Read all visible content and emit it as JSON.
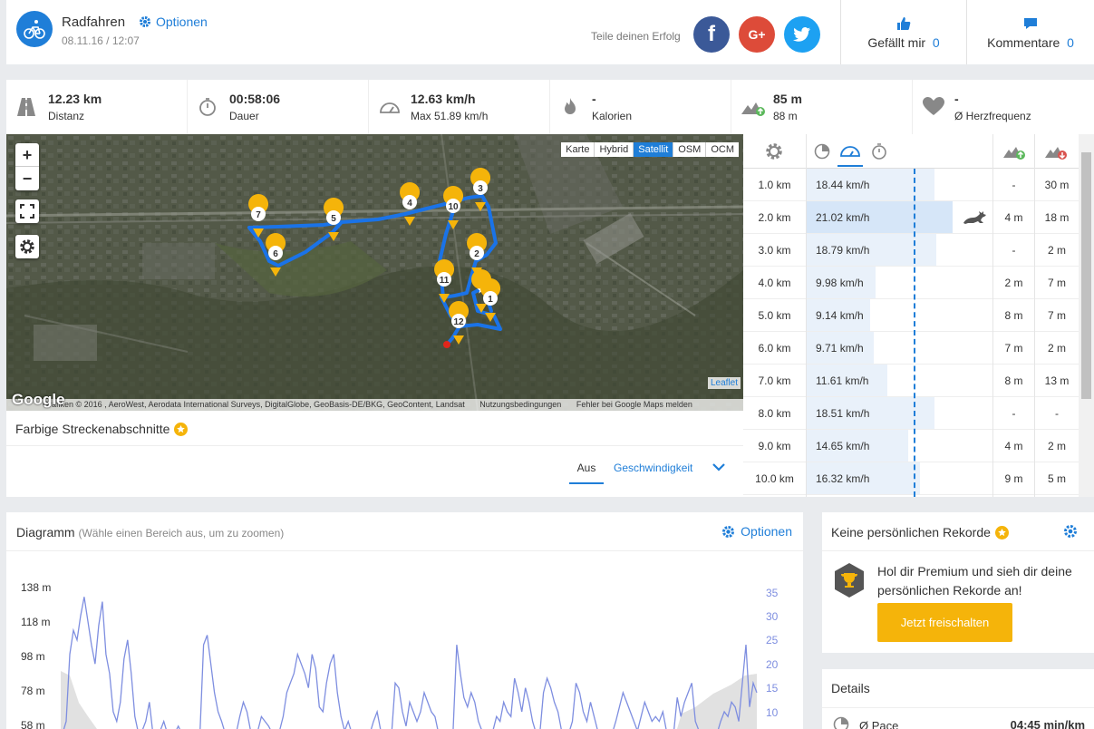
{
  "header": {
    "title": "Radfahren",
    "date": "08.11.16 / 12:07",
    "options_label": "Optionen",
    "share_label": "Teile deinen Erfolg",
    "like_label": "Gefällt mir",
    "like_count": "0",
    "comments_label": "Kommentare",
    "comments_count": "0",
    "sport_icon": "bicycle-icon"
  },
  "stats": [
    {
      "value": "12.23 km",
      "label": "Distanz",
      "icon": "road-icon"
    },
    {
      "value": "00:58:06",
      "label": "Dauer",
      "icon": "stopwatch-icon"
    },
    {
      "value": "12.63 km/h",
      "label": "Max 51.89 km/h",
      "icon": "speedometer-icon"
    },
    {
      "value": "-",
      "label": "Kalorien",
      "icon": "flame-icon"
    },
    {
      "value": "85 m",
      "label": "88 m",
      "icon": "elevation-icon"
    },
    {
      "value": "-",
      "label": "Ø Herzfrequenz",
      "icon": "heart-icon"
    }
  ],
  "map": {
    "layers": [
      "Karte",
      "Hybrid",
      "Satellit",
      "OSM",
      "OCM"
    ],
    "active_layer": "Satellit",
    "leaflet": "Leaflet",
    "google": "Google",
    "attribution": "Grafiken © 2016 , AeroWest, Aerodata International Surveys, DigitalGlobe, GeoBasis-DE/BKG, GeoContent, Landsat",
    "terms": "Nutzungsbedingungen",
    "report": "Fehler bei Google Maps melden",
    "markers": [
      "1",
      "2",
      "3",
      "4",
      "5",
      "6",
      "7",
      "10",
      "11",
      "12"
    ]
  },
  "segments": {
    "title": "Farbige Streckenabschnitte",
    "tab_off": "Aus",
    "tab_speed": "Geschwindigkeit"
  },
  "splits": {
    "rows": [
      {
        "km": "1.0 km",
        "speed": "18.44 km/h",
        "speed_value": 18.44,
        "up": "-",
        "down": "30 m"
      },
      {
        "km": "2.0 km",
        "speed": "21.02 km/h",
        "speed_value": 21.02,
        "up": "4 m",
        "down": "18 m",
        "best": true
      },
      {
        "km": "3.0 km",
        "speed": "18.79 km/h",
        "speed_value": 18.79,
        "up": "-",
        "down": "2 m"
      },
      {
        "km": "4.0 km",
        "speed": "9.98 km/h",
        "speed_value": 9.98,
        "up": "2 m",
        "down": "7 m"
      },
      {
        "km": "5.0 km",
        "speed": "9.14 km/h",
        "speed_value": 9.14,
        "up": "8 m",
        "down": "7 m"
      },
      {
        "km": "6.0 km",
        "speed": "9.71 km/h",
        "speed_value": 9.71,
        "up": "7 m",
        "down": "2 m"
      },
      {
        "km": "7.0 km",
        "speed": "11.61 km/h",
        "speed_value": 11.61,
        "up": "8 m",
        "down": "13 m"
      },
      {
        "km": "8.0 km",
        "speed": "18.51 km/h",
        "speed_value": 18.51,
        "up": "-",
        "down": "-"
      },
      {
        "km": "9.0 km",
        "speed": "14.65 km/h",
        "speed_value": 14.65,
        "up": "4 m",
        "down": "2 m"
      },
      {
        "km": "10.0 km",
        "speed": "16.32 km/h",
        "speed_value": 16.32,
        "up": "9 m",
        "down": "5 m"
      }
    ]
  },
  "diagram": {
    "title": "Diagramm",
    "subtitle": "(Wähle einen Bereich aus, um zu zoomen)",
    "options_label": "Optionen"
  },
  "chart_data": {
    "type": "line",
    "y_ticks_left": [
      "138 m",
      "118 m",
      "98 m",
      "78 m",
      "58 m"
    ],
    "y_ticks_right": [
      "35",
      "30",
      "25",
      "20",
      "15",
      "10"
    ],
    "series": [
      {
        "color": "#7e8ee0",
        "values": [
          5,
          8,
          22,
          27,
          25,
          30,
          34,
          29,
          24,
          20,
          28,
          33,
          22,
          18,
          10,
          8,
          12,
          21,
          25,
          18,
          9,
          5,
          6,
          8,
          12,
          4,
          3,
          6,
          8,
          4,
          3,
          5,
          7,
          4,
          3,
          2,
          4,
          6,
          5,
          24,
          26,
          20,
          14,
          10,
          8,
          4,
          6,
          3,
          5,
          9,
          12,
          10,
          6,
          4,
          6,
          9,
          8,
          7,
          3,
          4,
          6,
          9,
          14,
          16,
          18,
          22,
          20,
          18,
          15,
          22,
          19,
          11,
          10,
          16,
          20,
          22,
          14,
          9,
          6,
          8,
          4,
          2,
          6,
          4,
          3,
          5,
          8,
          10,
          6,
          3,
          2,
          4,
          16,
          15,
          10,
          7,
          12,
          10,
          8,
          10,
          14,
          12,
          10,
          9,
          4,
          3,
          2,
          4,
          6,
          24,
          18,
          13,
          11,
          14,
          12,
          8,
          6,
          4,
          5,
          6,
          9,
          8,
          12,
          10,
          9,
          17,
          14,
          10,
          15,
          12,
          8,
          4,
          3,
          14,
          17,
          15,
          12,
          10,
          6,
          3,
          5,
          8,
          16,
          14,
          10,
          8,
          12,
          9,
          6,
          4,
          3,
          6,
          4,
          8,
          11,
          14,
          12,
          10,
          8,
          6,
          9,
          12,
          10,
          8,
          9,
          8,
          10,
          6,
          3,
          4,
          13,
          9,
          12,
          14,
          16,
          8,
          6,
          4,
          2,
          5,
          6,
          4,
          8,
          10,
          9,
          12,
          11,
          8,
          16,
          24,
          11,
          16,
          14
        ]
      }
    ]
  },
  "records": {
    "title": "Keine persönlichen Rekorde",
    "text": "Hol dir Premium und sieh dir deine persönlichen Rekorde an!",
    "button": "Jetzt freischalten"
  },
  "details": {
    "title": "Details",
    "pace_label": "Ø Pace",
    "pace_value": "04:45 min/km"
  },
  "colors": {
    "accent": "#1f7ed8",
    "facebook": "#3b5998",
    "google": "#dd4b39",
    "twitter": "#1da1f2",
    "premium": "#f5b40a",
    "route": "#1a73e8",
    "marker": "#f5b40a"
  }
}
